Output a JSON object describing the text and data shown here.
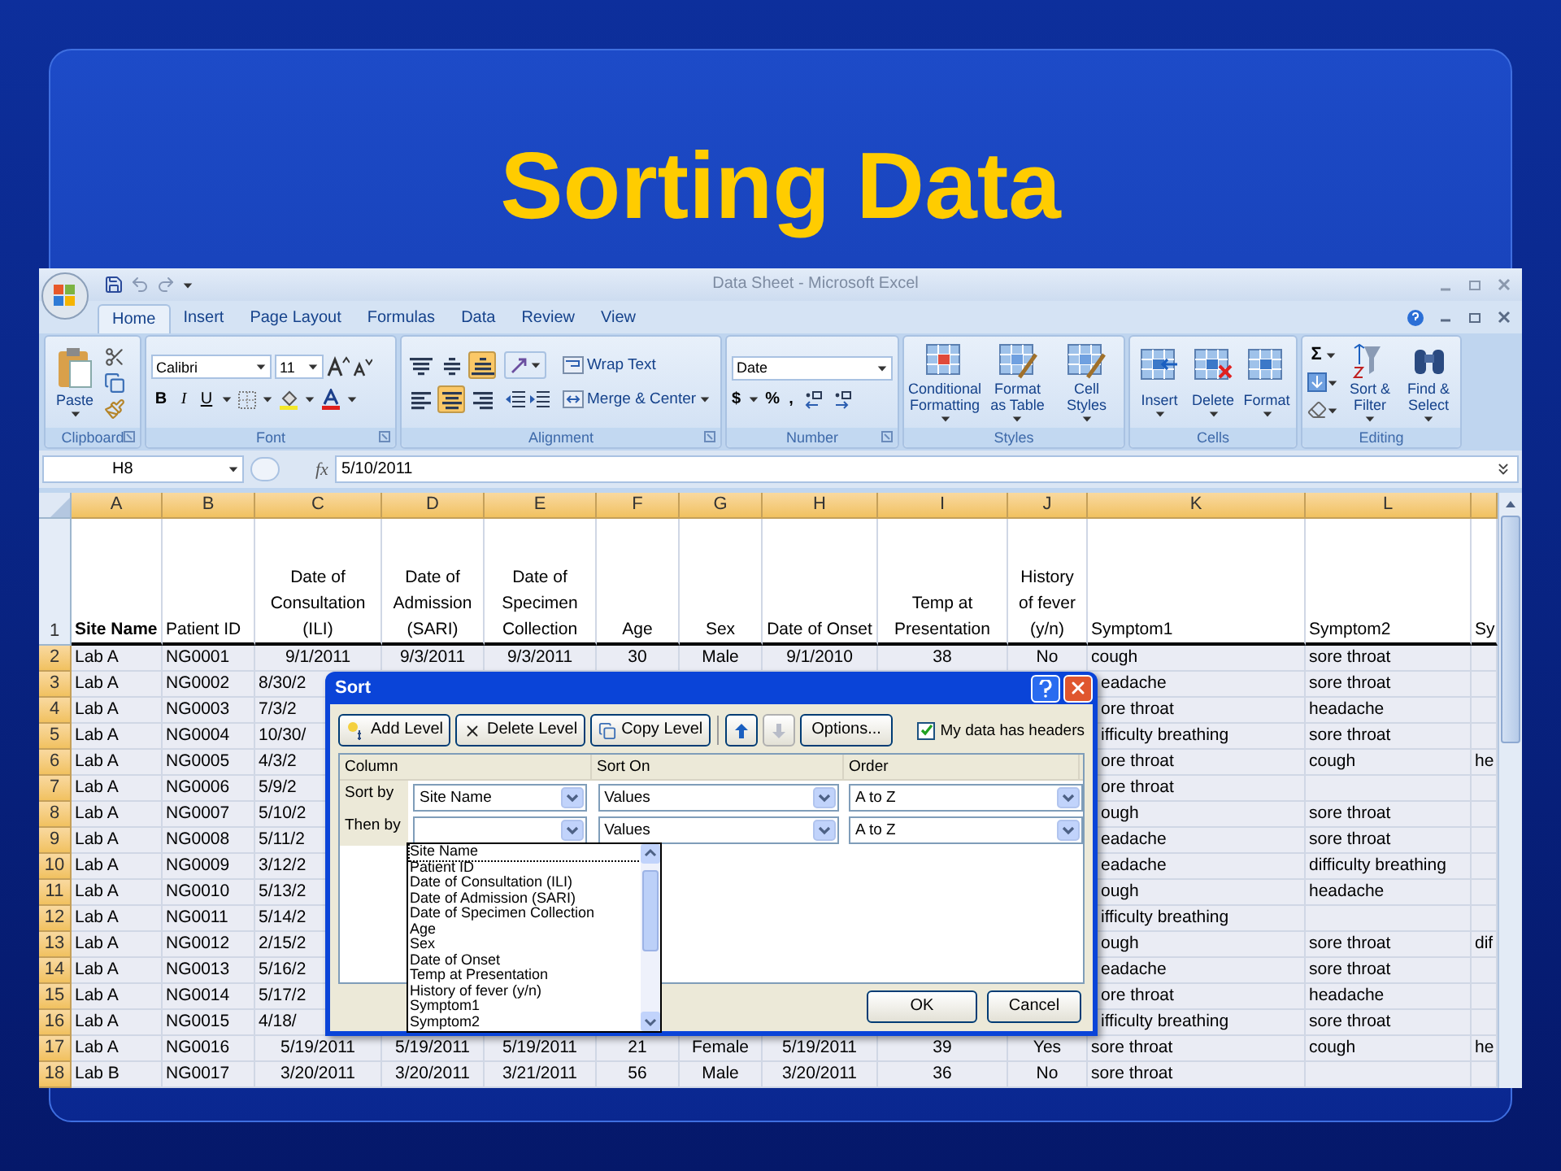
{
  "slide": {
    "title": "Sorting Data"
  },
  "excel": {
    "title": "Data Sheet - Microsoft Excel",
    "tabs": [
      {
        "label": "Home",
        "selected": true
      },
      {
        "label": "Insert",
        "selected": false
      },
      {
        "label": "Page Layout",
        "selected": false
      },
      {
        "label": "Formulas",
        "selected": false
      },
      {
        "label": "Data",
        "selected": false
      },
      {
        "label": "Review",
        "selected": false
      },
      {
        "label": "View",
        "selected": false
      }
    ],
    "ribbon": {
      "clipboard": {
        "label": "Clipboard",
        "paste": "Paste"
      },
      "font": {
        "label": "Font",
        "font_name": "Calibri",
        "font_size": "11",
        "bold": "B",
        "italic": "I",
        "underline": "U"
      },
      "alignment": {
        "label": "Alignment",
        "vertical_align": [
          {
            "kind": "top",
            "selected": false
          },
          {
            "kind": "middle",
            "selected": false
          },
          {
            "kind": "bottom",
            "selected": true
          }
        ],
        "horizontal_align": [
          {
            "kind": "left",
            "selected": false
          },
          {
            "kind": "center",
            "selected": true
          },
          {
            "kind": "right",
            "selected": false
          }
        ],
        "wrap_text": "Wrap Text",
        "merge_center": "Merge & Center"
      },
      "number": {
        "label": "Number",
        "format": "Date",
        "currency": "$",
        "percent": "%",
        "comma": ","
      },
      "styles": {
        "label": "Styles",
        "buttons": [
          "Conditional Formatting",
          "Format as Table",
          "Cell Styles"
        ]
      },
      "cells": {
        "label": "Cells",
        "buttons": [
          "Insert",
          "Delete",
          "Format"
        ]
      },
      "editing": {
        "label": "Editing",
        "sum": "Σ",
        "buttons": [
          "Sort & Filter",
          "Find & Select"
        ]
      }
    },
    "formula_bar": {
      "name_box": "H8",
      "fx": "fx",
      "value": "5/10/2011"
    },
    "columns": [
      {
        "letter": "A",
        "header": "Site Name",
        "bold": true
      },
      {
        "letter": "B",
        "header": "Patient ID",
        "bold": false
      },
      {
        "letter": "C",
        "header": "Date of Consultation (ILI)",
        "bold": false
      },
      {
        "letter": "D",
        "header": "Date of Admission (SARI)",
        "bold": false
      },
      {
        "letter": "E",
        "header": "Date of Specimen Collection",
        "bold": false
      },
      {
        "letter": "F",
        "header": "Age",
        "bold": false
      },
      {
        "letter": "G",
        "header": "Sex",
        "bold": false
      },
      {
        "letter": "H",
        "header": "Date of Onset",
        "bold": false
      },
      {
        "letter": "I",
        "header": "Temp at Presentation",
        "bold": false
      },
      {
        "letter": "J",
        "header": "History of fever (y/n)",
        "bold": false
      },
      {
        "letter": "K",
        "header": "Symptom1",
        "bold": false
      },
      {
        "letter": "L",
        "header": "Symptom2",
        "bold": false
      },
      {
        "header": "Sy",
        "bold": false
      }
    ],
    "header_row_number": "1",
    "rows": [
      {
        "number": "2",
        "selected": true,
        "under_dialog": false,
        "cells": [
          "Lab A",
          "NG0001",
          "9/1/2011",
          "9/3/2011",
          "9/3/2011",
          "30",
          "Male",
          "9/1/2010",
          "38",
          "No",
          "cough",
          "sore throat"
        ]
      },
      {
        "number": "3",
        "selected": true,
        "under_dialog": true,
        "cells": [
          "Lab A",
          "NG0002",
          "8/30/2",
          null,
          null,
          null,
          null,
          null,
          null,
          null,
          "eadache",
          "sore throat"
        ]
      },
      {
        "number": "4",
        "selected": true,
        "under_dialog": true,
        "cells": [
          "Lab A",
          "NG0003",
          "7/3/2",
          null,
          null,
          null,
          null,
          null,
          null,
          null,
          "ore throat",
          "headache"
        ]
      },
      {
        "number": "5",
        "selected": true,
        "under_dialog": true,
        "cells": [
          "Lab A",
          "NG0004",
          "10/30/",
          null,
          null,
          null,
          null,
          null,
          null,
          null,
          "ifficulty breathing",
          "sore throat"
        ]
      },
      {
        "number": "6",
        "selected": true,
        "under_dialog": true,
        "cells": [
          "Lab A",
          "NG0005",
          "4/3/2",
          null,
          null,
          null,
          null,
          null,
          null,
          null,
          "ore throat",
          "cough",
          "he"
        ]
      },
      {
        "number": "7",
        "selected": true,
        "under_dialog": true,
        "cells": [
          "Lab A",
          "NG0006",
          "5/9/2",
          null,
          null,
          null,
          null,
          null,
          null,
          null,
          "ore throat"
        ]
      },
      {
        "number": "8",
        "selected": true,
        "under_dialog": true,
        "cells": [
          "Lab A",
          "NG0007",
          "5/10/2",
          null,
          null,
          null,
          null,
          null,
          null,
          null,
          "ough",
          "sore throat"
        ]
      },
      {
        "number": "9",
        "selected": true,
        "under_dialog": true,
        "cells": [
          "Lab A",
          "NG0008",
          "5/11/2",
          null,
          null,
          null,
          null,
          null,
          null,
          null,
          "eadache",
          "sore throat"
        ]
      },
      {
        "number": "10",
        "selected": true,
        "under_dialog": true,
        "cells": [
          "Lab A",
          "NG0009",
          "3/12/2",
          null,
          null,
          null,
          null,
          null,
          null,
          null,
          "eadache",
          "difficulty breathing"
        ]
      },
      {
        "number": "11",
        "selected": true,
        "under_dialog": true,
        "cells": [
          "Lab A",
          "NG0010",
          "5/13/2",
          null,
          null,
          null,
          null,
          null,
          null,
          null,
          "ough",
          "headache"
        ]
      },
      {
        "number": "12",
        "selected": true,
        "under_dialog": true,
        "cells": [
          "Lab A",
          "NG0011",
          "5/14/2",
          null,
          null,
          null,
          null,
          null,
          null,
          null,
          "ifficulty breathing"
        ]
      },
      {
        "number": "13",
        "selected": true,
        "under_dialog": true,
        "cells": [
          "Lab A",
          "NG0012",
          "2/15/2",
          null,
          null,
          null,
          null,
          null,
          null,
          null,
          "ough",
          "sore throat",
          "dif"
        ]
      },
      {
        "number": "14",
        "selected": true,
        "under_dialog": true,
        "cells": [
          "Lab A",
          "NG0013",
          "5/16/2",
          null,
          null,
          null,
          null,
          null,
          null,
          null,
          "eadache",
          "sore throat"
        ]
      },
      {
        "number": "15",
        "selected": true,
        "under_dialog": true,
        "cells": [
          "Lab A",
          "NG0014",
          "5/17/2",
          null,
          null,
          null,
          null,
          null,
          null,
          null,
          "ore throat",
          "headache"
        ]
      },
      {
        "number": "16",
        "selected": true,
        "under_dialog": true,
        "cells": [
          "Lab A",
          "NG0015",
          "4/18/",
          null,
          null,
          null,
          null,
          null,
          null,
          null,
          "ifficulty breathing",
          "sore throat"
        ]
      },
      {
        "number": "17",
        "selected": true,
        "under_dialog": false,
        "cells": [
          "Lab A",
          "NG0016",
          "5/19/2011",
          "5/19/2011",
          "5/19/2011",
          "21",
          "Female",
          "5/19/2011",
          "39",
          "Yes",
          "sore throat",
          "cough",
          "he"
        ]
      },
      {
        "number": "18",
        "selected": true,
        "under_dialog": false,
        "cells": [
          "Lab B",
          "NG0017",
          "3/20/2011",
          "3/20/2011",
          "3/21/2011",
          "56",
          "Male",
          "3/20/2011",
          "36",
          "No",
          "sore throat"
        ]
      }
    ],
    "sort_dialog": {
      "title": "Sort",
      "add_level": "Add Level",
      "delete_level": "Delete Level",
      "copy_level": "Copy Level",
      "move_buttons": [
        {
          "kind": "up",
          "disabled": false
        },
        {
          "kind": "down",
          "disabled": true
        }
      ],
      "options": "Options...",
      "headers_checkbox": {
        "label": "My data has headers",
        "checked": true
      },
      "columns": [
        "Column",
        "Sort On",
        "Order"
      ],
      "levels": [
        {
          "label": "Sort by",
          "column": "Site Name",
          "sort_on": "Values",
          "order": "A to Z"
        },
        {
          "label": "Then by",
          "sort_on": "Values",
          "order": "A to Z"
        }
      ],
      "column_list": [
        {
          "label": "Site Name",
          "selected": true
        },
        {
          "label": "Patient ID",
          "selected": false
        },
        {
          "label": "Date of Consultation (ILI)",
          "selected": false
        },
        {
          "label": "Date of Admission (SARI)",
          "selected": false
        },
        {
          "label": "Date of Specimen Collection",
          "selected": false
        },
        {
          "label": "Age",
          "selected": false
        },
        {
          "label": "Sex",
          "selected": false
        },
        {
          "label": "Date of Onset",
          "selected": false
        },
        {
          "label": "Temp at Presentation",
          "selected": false
        },
        {
          "label": "History of fever (y/n)",
          "selected": false
        },
        {
          "label": "Symptom1",
          "selected": false
        },
        {
          "label": "Symptom2",
          "selected": false
        }
      ],
      "ok": "OK",
      "cancel": "Cancel"
    }
  }
}
